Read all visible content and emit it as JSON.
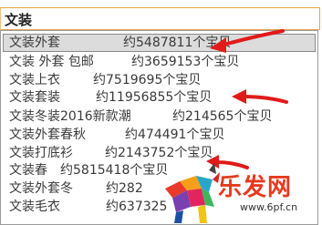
{
  "search": {
    "value": "文装"
  },
  "suggestions": [
    {
      "term": "文装外套",
      "count": "约5487811个宝贝",
      "selected": true
    },
    {
      "term": "文装 外套 包邮",
      "count": "约3659153个宝贝",
      "selected": false
    },
    {
      "term": "文装上衣",
      "count": "约7519695个宝贝",
      "selected": false
    },
    {
      "term": "文装套装",
      "count": "约11956855个宝贝",
      "selected": false
    },
    {
      "term": "文装冬装2016新款潮",
      "count": "约214565个宝贝",
      "selected": false
    },
    {
      "term": "文装外套春秋",
      "count": "约474491个宝贝",
      "selected": false
    },
    {
      "term": "文装打底衫",
      "count": "约2143752个宝贝",
      "selected": false
    },
    {
      "term": "文装春",
      "count": "约5815418个宝贝",
      "selected": false
    },
    {
      "term": "文装外套冬",
      "count": "约282",
      "selected": false
    },
    {
      "term": "文装毛衣",
      "count": "约637325",
      "selected": false
    }
  ],
  "watermark": {
    "brand": "乐发网",
    "url": "www.6pf.cn"
  },
  "colors": {
    "arrow": "#e11a1a",
    "selected_row_bg": "#dcdcdc",
    "search_border": "#e8a54c"
  }
}
